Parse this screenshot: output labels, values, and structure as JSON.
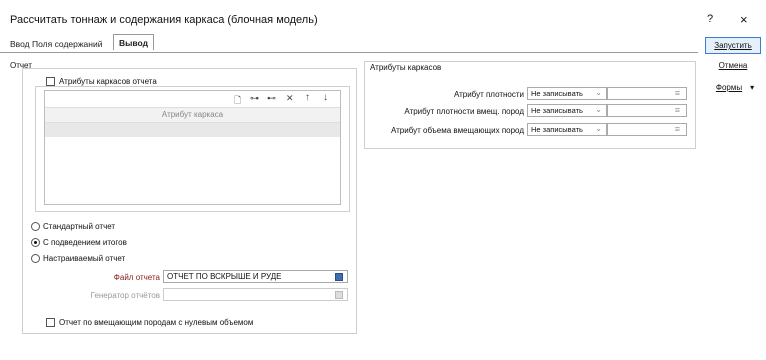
{
  "window": {
    "title": "Рассчитать тоннаж и содержания каркаса (блочная модель)",
    "help_label": "?",
    "close_label": "×"
  },
  "tabs": [
    {
      "label": "Ввод",
      "active": false
    },
    {
      "label": "Поля содержаний",
      "active": false
    },
    {
      "label": "Вывод",
      "active": true
    }
  ],
  "side_buttons": {
    "run": "Запустить",
    "cancel": "Отмена",
    "forms": "Формы",
    "forms_arrow": "▾"
  },
  "report": {
    "group_title": "Отчет",
    "attributes_checkbox": {
      "label": "Атрибуты каркасов отчета",
      "checked": false
    },
    "table_header": "Атрибут каркаса",
    "toolbar_icons": [
      "new-icon",
      "insert-icon",
      "append-icon",
      "delete-icon",
      "move-up-icon",
      "move-down-icon"
    ],
    "toolbar_glyphs": [
      "🗋",
      "⊶",
      "⊷",
      "✕",
      "↑",
      "↓"
    ],
    "radios": [
      {
        "label": "Стандартный отчет",
        "selected": false
      },
      {
        "label": "С подведением итогов",
        "selected": true
      },
      {
        "label": "Настраиваемый отчет",
        "selected": false
      }
    ],
    "report_file_label": "Файл отчета",
    "report_file_value": "ОТЧЕТ ПО ВСКРЫШЕ И РУДЕ",
    "generator_label": "Генератор отчётов",
    "generator_value": "",
    "zero_volume_checkbox": {
      "label": "Отчет по вмещающим породам с нулевым объемом",
      "checked": false
    }
  },
  "wireframe_attributes": {
    "group_title": "Атрибуты каркасов",
    "rows": [
      {
        "label": "Атрибут плотности",
        "combo": "Не записывать",
        "field": ""
      },
      {
        "label": "Атрибут плотности вмещ. пород",
        "combo": "Не записывать",
        "field": ""
      },
      {
        "label": "Атрибут объема вмещающих пород",
        "combo": "Не записывать",
        "field": ""
      }
    ],
    "combo_arrow": "⌄",
    "field_icon": "≡"
  },
  "colors": {
    "required_label": "#8b1a1a",
    "disabled_label": "#9a9a9a",
    "accent": "#3d7bd6"
  }
}
